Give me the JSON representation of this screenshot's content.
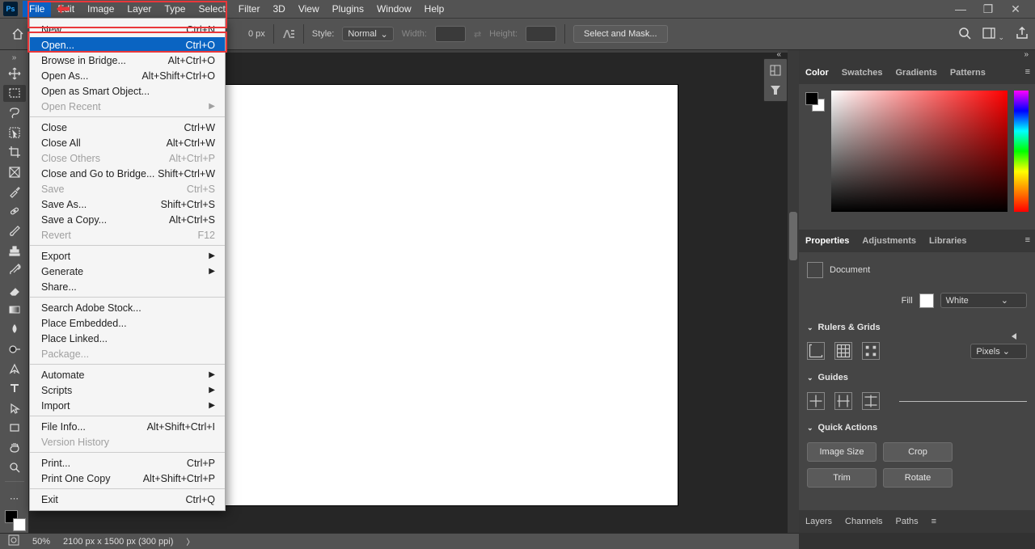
{
  "menubar": [
    "File",
    "Edit",
    "Image",
    "Layer",
    "Type",
    "Select",
    "Filter",
    "3D",
    "View",
    "Plugins",
    "Window",
    "Help"
  ],
  "optionsbar": {
    "px": "0 px",
    "style_label": "Style:",
    "style_value": "Normal",
    "width_label": "Width:",
    "height_label": "Height:",
    "mask_btn": "Select and Mask..."
  },
  "dropdown": [
    {
      "t": "item",
      "label": "New...",
      "short": "Ctrl+N"
    },
    {
      "t": "item",
      "label": "Open...",
      "short": "Ctrl+O",
      "hover": true
    },
    {
      "t": "item",
      "label": "Browse in Bridge...",
      "short": "Alt+Ctrl+O"
    },
    {
      "t": "item",
      "label": "Open As...",
      "short": "Alt+Shift+Ctrl+O"
    },
    {
      "t": "item",
      "label": "Open as Smart Object..."
    },
    {
      "t": "sub",
      "label": "Open Recent",
      "disabled": true
    },
    {
      "t": "sep"
    },
    {
      "t": "item",
      "label": "Close",
      "short": "Ctrl+W"
    },
    {
      "t": "item",
      "label": "Close All",
      "short": "Alt+Ctrl+W"
    },
    {
      "t": "item",
      "label": "Close Others",
      "short": "Alt+Ctrl+P",
      "disabled": true
    },
    {
      "t": "item",
      "label": "Close and Go to Bridge...",
      "short": "Shift+Ctrl+W"
    },
    {
      "t": "item",
      "label": "Save",
      "short": "Ctrl+S",
      "disabled": true
    },
    {
      "t": "item",
      "label": "Save As...",
      "short": "Shift+Ctrl+S"
    },
    {
      "t": "item",
      "label": "Save a Copy...",
      "short": "Alt+Ctrl+S"
    },
    {
      "t": "item",
      "label": "Revert",
      "short": "F12",
      "disabled": true
    },
    {
      "t": "sep"
    },
    {
      "t": "sub",
      "label": "Export"
    },
    {
      "t": "sub",
      "label": "Generate"
    },
    {
      "t": "item",
      "label": "Share..."
    },
    {
      "t": "sep"
    },
    {
      "t": "item",
      "label": "Search Adobe Stock..."
    },
    {
      "t": "item",
      "label": "Place Embedded..."
    },
    {
      "t": "item",
      "label": "Place Linked..."
    },
    {
      "t": "item",
      "label": "Package...",
      "disabled": true
    },
    {
      "t": "sep"
    },
    {
      "t": "sub",
      "label": "Automate"
    },
    {
      "t": "sub",
      "label": "Scripts"
    },
    {
      "t": "sub",
      "label": "Import"
    },
    {
      "t": "sep"
    },
    {
      "t": "item",
      "label": "File Info...",
      "short": "Alt+Shift+Ctrl+I"
    },
    {
      "t": "item",
      "label": "Version History",
      "disabled": true
    },
    {
      "t": "sep"
    },
    {
      "t": "item",
      "label": "Print...",
      "short": "Ctrl+P"
    },
    {
      "t": "item",
      "label": "Print One Copy",
      "short": "Alt+Shift+Ctrl+P"
    },
    {
      "t": "sep"
    },
    {
      "t": "item",
      "label": "Exit",
      "short": "Ctrl+Q"
    }
  ],
  "color_tabs": [
    "Color",
    "Swatches",
    "Gradients",
    "Patterns"
  ],
  "prop_tabs": [
    "Properties",
    "Adjustments",
    "Libraries"
  ],
  "properties": {
    "doc_label": "Document",
    "fill_label": "Fill",
    "fill_value": "White",
    "rulers_header": "Rulers & Grids",
    "units": "Pixels",
    "guides_header": "Guides",
    "quick_header": "Quick Actions",
    "qa": [
      "Image Size",
      "Crop",
      "Trim",
      "Rotate"
    ]
  },
  "layers_tabs": [
    "Layers",
    "Channels",
    "Paths"
  ],
  "status": {
    "zoom": "50%",
    "dims": "2100 px x 1500 px (300 ppi)"
  }
}
